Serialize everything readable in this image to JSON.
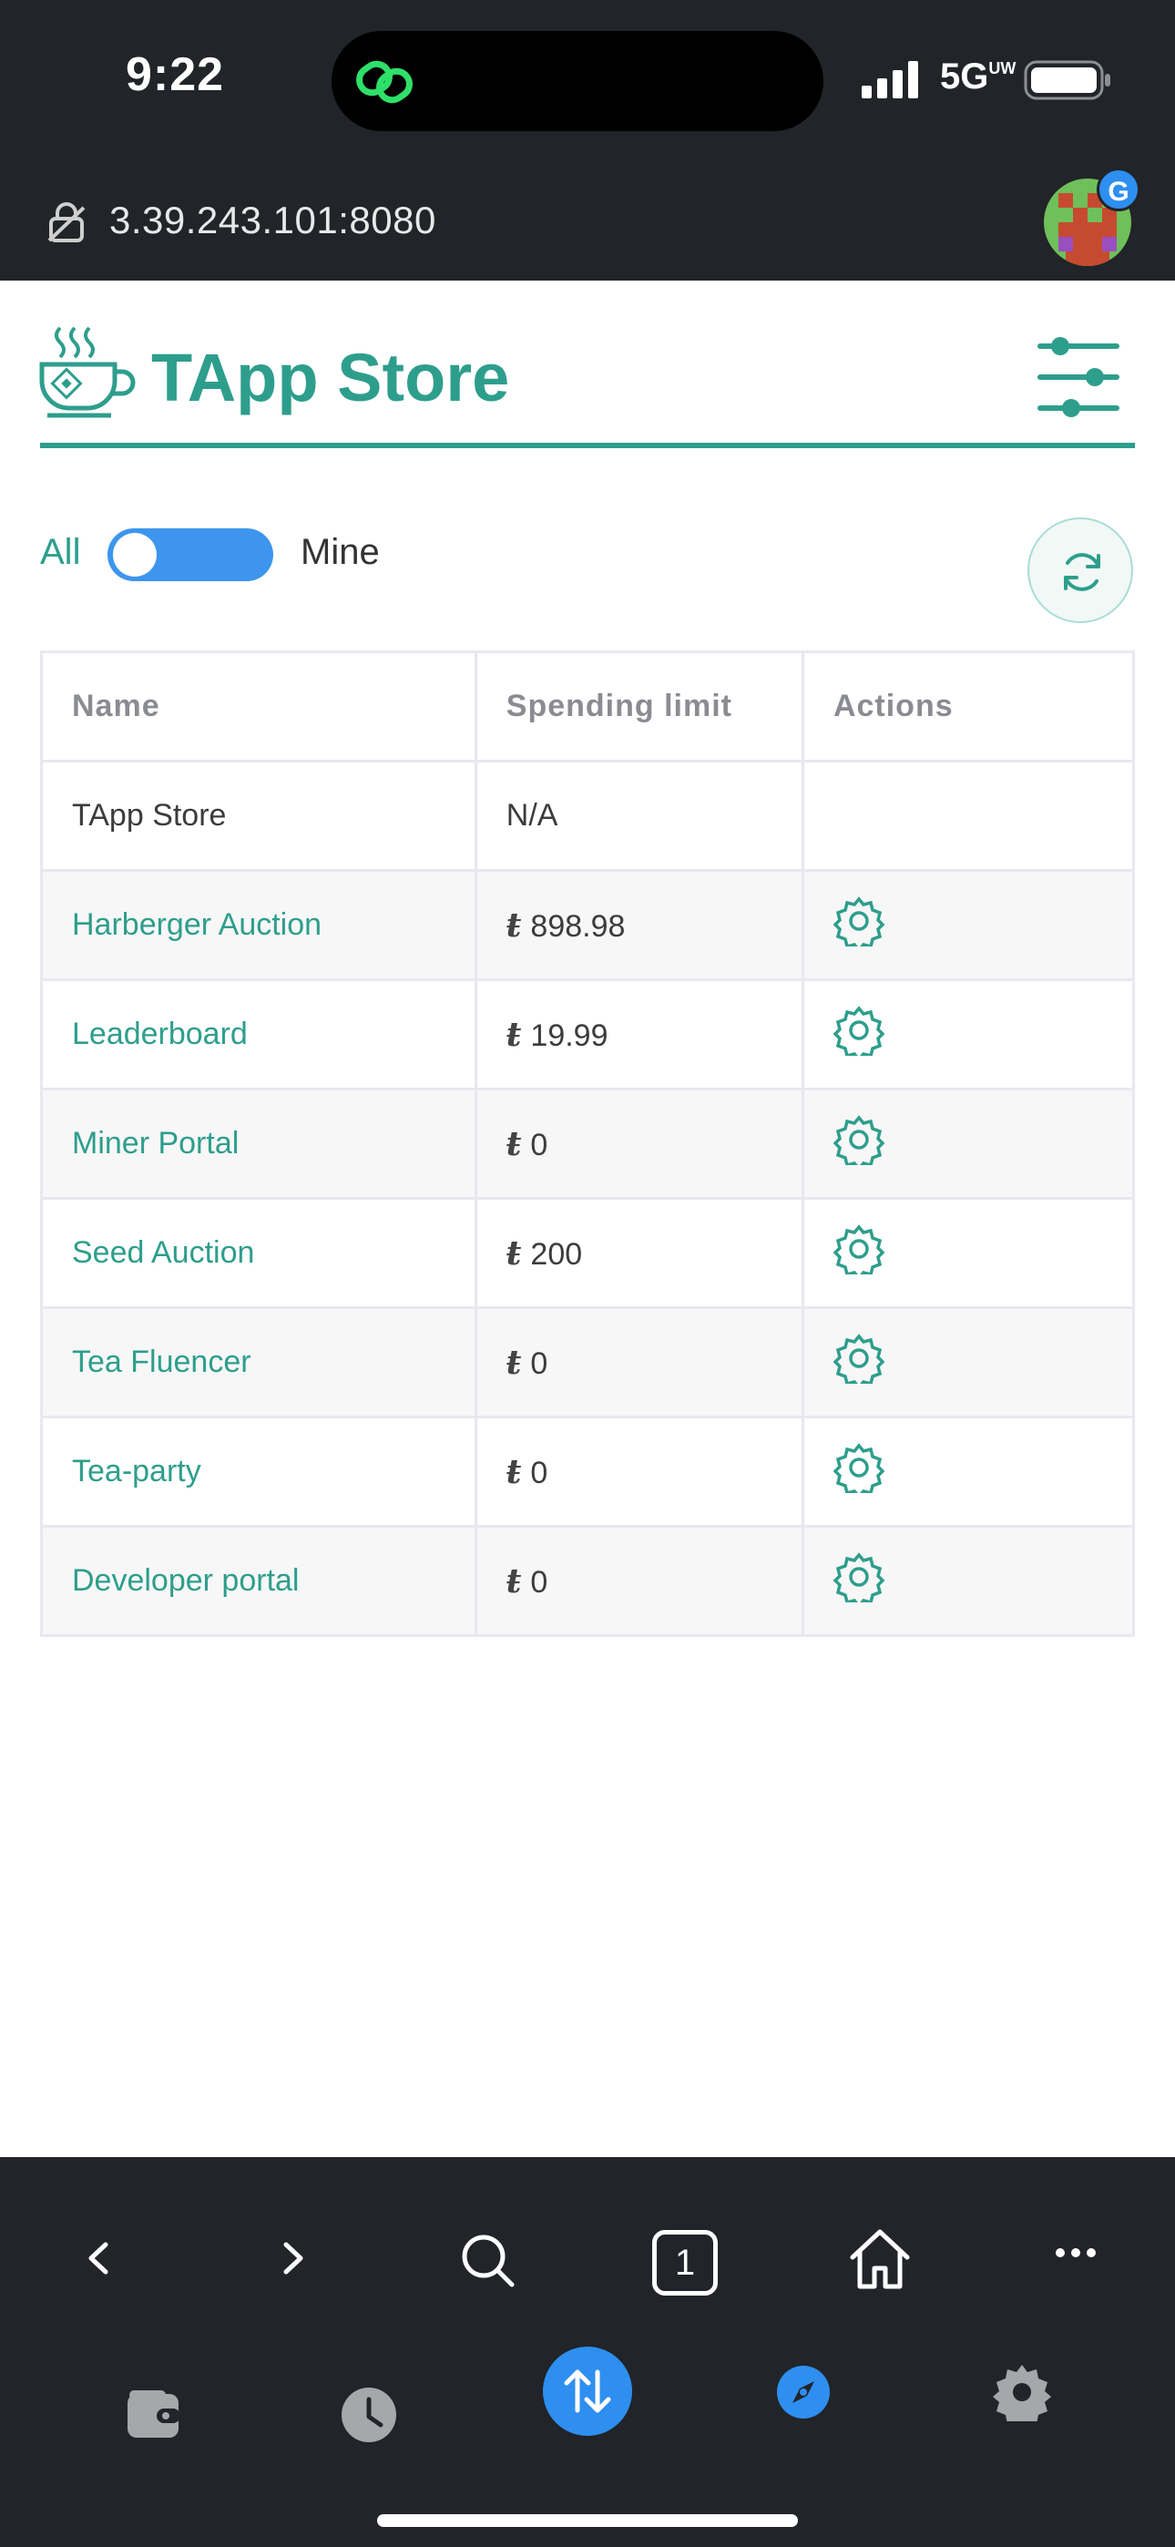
{
  "status_bar": {
    "time": "9:22",
    "network": "5G",
    "network_sub": "UW"
  },
  "browser": {
    "url": "3.39.243.101:8080",
    "avatar_badge": "G"
  },
  "header": {
    "title": "TApp Store"
  },
  "filter": {
    "left_label": "All",
    "right_label": "Mine",
    "toggle_state": "all"
  },
  "table": {
    "columns": [
      "Name",
      "Spending limit",
      "Actions"
    ],
    "rows": [
      {
        "name": "TApp Store",
        "limit": "N/A",
        "has_token": false,
        "has_action": false,
        "link": false
      },
      {
        "name": "Harberger Auction",
        "limit": "898.98",
        "has_token": true,
        "has_action": true,
        "link": true
      },
      {
        "name": "Leaderboard",
        "limit": "19.99",
        "has_token": true,
        "has_action": true,
        "link": true
      },
      {
        "name": "Miner Portal",
        "limit": "0",
        "has_token": true,
        "has_action": true,
        "link": true
      },
      {
        "name": "Seed Auction",
        "limit": "200",
        "has_token": true,
        "has_action": true,
        "link": true
      },
      {
        "name": "Tea Fluencer",
        "limit": "0",
        "has_token": true,
        "has_action": true,
        "link": true
      },
      {
        "name": "Tea-party",
        "limit": "0",
        "has_token": true,
        "has_action": true,
        "link": true
      },
      {
        "name": "Developer portal",
        "limit": "0",
        "has_token": true,
        "has_action": true,
        "link": true
      }
    ],
    "token_symbol": "ŧ"
  },
  "toolbar": {
    "tab_count": "1",
    "icons": [
      "back-icon",
      "forward-icon",
      "search-icon",
      "tabs-icon",
      "home-icon",
      "more-icon"
    ],
    "dock_icons": [
      "wallet-icon",
      "history-icon",
      "swap-icon",
      "explore-icon",
      "settings-icon"
    ]
  },
  "colors": {
    "accent": "#2e9e8c",
    "toggle": "#3d95ee",
    "chrome": "#212428",
    "blue": "#2e8ff0"
  }
}
